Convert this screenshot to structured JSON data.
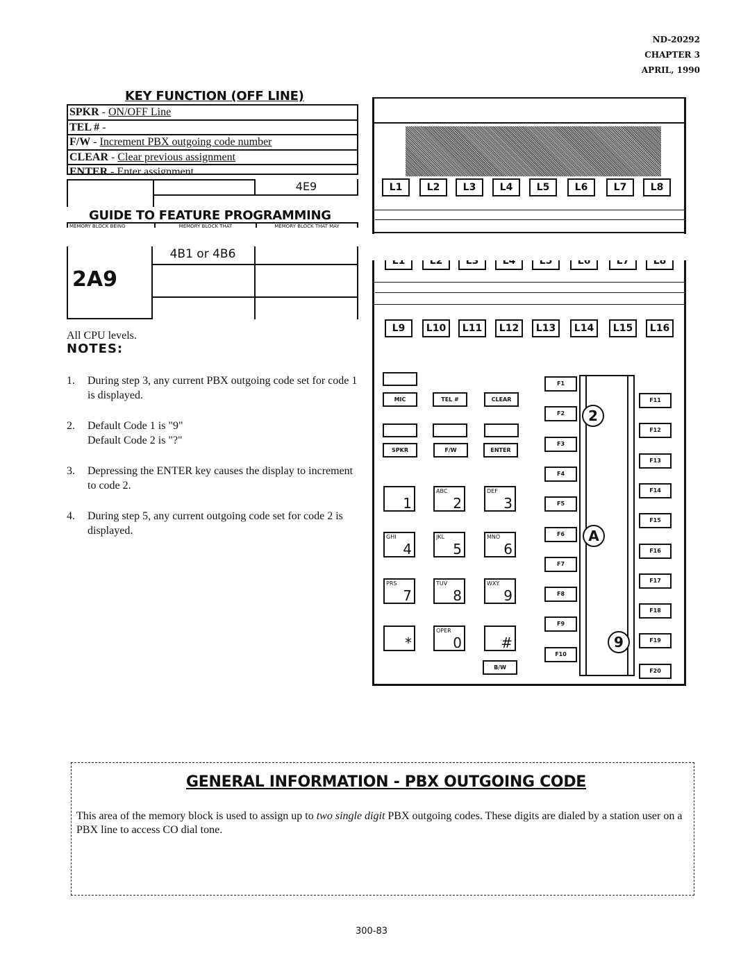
{
  "header": {
    "doc_number": "ND-20292",
    "chapter": "CHAPTER 3",
    "date": "APRIL, 1990"
  },
  "key_function": {
    "title": "KEY FUNCTION (OFF LINE)",
    "rows": [
      {
        "key": "SPKR",
        "desc": "ON/OFF Line"
      },
      {
        "key": "TEL #",
        "desc": ""
      },
      {
        "key": "F/W",
        "desc": "Increment PBX outgoing code number"
      },
      {
        "key": "CLEAR",
        "desc": "Clear previous assignment"
      },
      {
        "key": "ENTER",
        "desc": "Enter assignment"
      }
    ],
    "block_value": "4E9"
  },
  "guide": {
    "title": "GUIDE TO FEATURE PROGRAMMING",
    "col_headers": [
      "MEMORY BLOCK BEING",
      "MEMORY BLOCK THAT",
      "MEMORY BLOCK THAT MAY"
    ],
    "block": "2A9",
    "related": "4B1 or 4B6"
  },
  "cpu_levels": "All CPU levels.",
  "notes": {
    "title": "NOTES:",
    "items": [
      {
        "num": "1.",
        "text": "During step 3, any current PBX outgoing code set for code 1 is displayed."
      },
      {
        "num": "2.",
        "text": "Default Code 1 is \"9\"\nDefault Code 2 is \"?\""
      },
      {
        "num": "3.",
        "text": "Depressing the ENTER key causes the display to increment to code 2."
      },
      {
        "num": "4.",
        "text": "During step 5, any current outgoing code set for code 2 is displayed."
      }
    ]
  },
  "phone": {
    "line_keys_top": [
      "L1",
      "L2",
      "L3",
      "L4",
      "L5",
      "L6",
      "L7",
      "L8"
    ],
    "line_keys_bottom": [
      "L9",
      "L10",
      "L11",
      "L12",
      "L13",
      "L14",
      "L15",
      "L16"
    ],
    "function_keys": [
      "MIC",
      "TEL #",
      "CLEAR",
      "SPKR",
      "F/W",
      "ENTER",
      "B/W"
    ],
    "dial_keys": [
      {
        "letters": "",
        "digit": "1"
      },
      {
        "letters": "ABC",
        "digit": "2"
      },
      {
        "letters": "DEF",
        "digit": "3"
      },
      {
        "letters": "GHI",
        "digit": "4"
      },
      {
        "letters": "JKL",
        "digit": "5"
      },
      {
        "letters": "MNO",
        "digit": "6"
      },
      {
        "letters": "PRS",
        "digit": "7"
      },
      {
        "letters": "TUV",
        "digit": "8"
      },
      {
        "letters": "WXY",
        "digit": "9"
      },
      {
        "letters": "",
        "digit": "*"
      },
      {
        "letters": "OPER",
        "digit": "0"
      },
      {
        "letters": "",
        "digit": "#"
      }
    ],
    "f_keys_left": [
      "F1",
      "F2",
      "F3",
      "F4",
      "F5",
      "F6",
      "F7",
      "F8",
      "F9",
      "F10"
    ],
    "f_keys_right": [
      "F11",
      "F12",
      "F13",
      "F14",
      "F15",
      "F16",
      "F17",
      "F18",
      "F19",
      "F20"
    ],
    "step_markers": [
      "2",
      "A",
      "9"
    ]
  },
  "general_info": {
    "title": "GENERAL INFORMATION  -  PBX OUTGOING CODE",
    "body_pre": "This area of the memory block is used to assign up to ",
    "body_em": "two single digit",
    "body_post": " PBX outgoing codes.  These digits are dialed by a station user on a PBX line to access CO dial tone."
  },
  "page_number": "300-83"
}
